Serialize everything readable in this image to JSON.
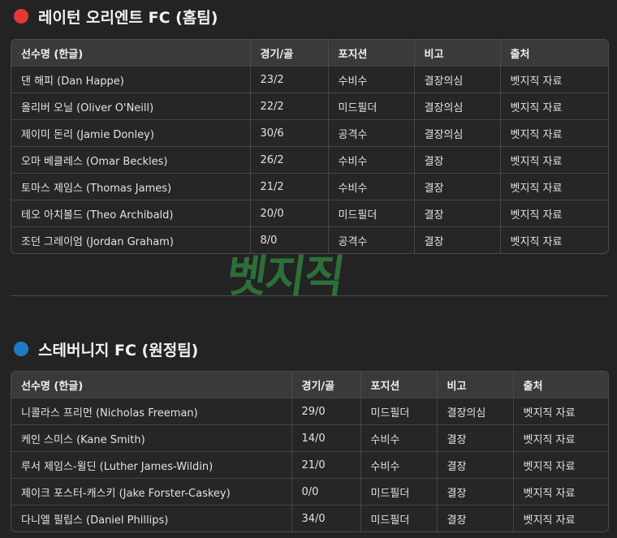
{
  "home": {
    "title": "레이턴 오리엔트 FC (홈팀)",
    "dot_color": "#e53935",
    "headers": [
      "선수명 (한글)",
      "경기/골",
      "포지션",
      "비고",
      "출처"
    ],
    "rows": [
      [
        "댄 해피 (Dan Happe)",
        "23/2",
        "수비수",
        "결장의심",
        "벳지직 자료"
      ],
      [
        "올리버 오닐 (Oliver O'Neill)",
        "22/2",
        "미드필더",
        "결장의심",
        "벳지직 자료"
      ],
      [
        "제이미 돈리 (Jamie Donley)",
        "30/6",
        "공격수",
        "결장의심",
        "벳지직 자료"
      ],
      [
        "오마 베클레스 (Omar Beckles)",
        "26/2",
        "수비수",
        "결장",
        "벳지직 자료"
      ],
      [
        "토마스 제임스 (Thomas James)",
        "21/2",
        "수비수",
        "결장",
        "벳지직 자료"
      ],
      [
        "테오 아치볼드 (Theo Archibald)",
        "20/0",
        "미드필더",
        "결장",
        "벳지직 자료"
      ],
      [
        "조던 그레이엄 (Jordan Graham)",
        "8/0",
        "공격수",
        "결장",
        "벳지직 자료"
      ]
    ]
  },
  "away": {
    "title": "스테버니지 FC (원정팀)",
    "dot_color": "#1e7bc4",
    "headers": [
      "선수명 (한글)",
      "경기/골",
      "포지션",
      "비고",
      "출처"
    ],
    "rows": [
      [
        "니콜라스 프리먼 (Nicholas Freeman)",
        "29/0",
        "미드필더",
        "결장의심",
        "벳지직 자료"
      ],
      [
        "케인 스미스 (Kane Smith)",
        "14/0",
        "수비수",
        "결장",
        "벳지직 자료"
      ],
      [
        "루서 제임스-윌딘 (Luther James-Wildin)",
        "21/0",
        "수비수",
        "결장",
        "벳지직 자료"
      ],
      [
        "제이크 포스터-캐스키 (Jake Forster-Caskey)",
        "0/0",
        "미드필더",
        "결장",
        "벳지직 자료"
      ],
      [
        "다니엘 필립스 (Daniel Phillips)",
        "34/0",
        "미드필더",
        "결장",
        "벳지직 자료"
      ]
    ]
  },
  "watermark": "벳지직"
}
